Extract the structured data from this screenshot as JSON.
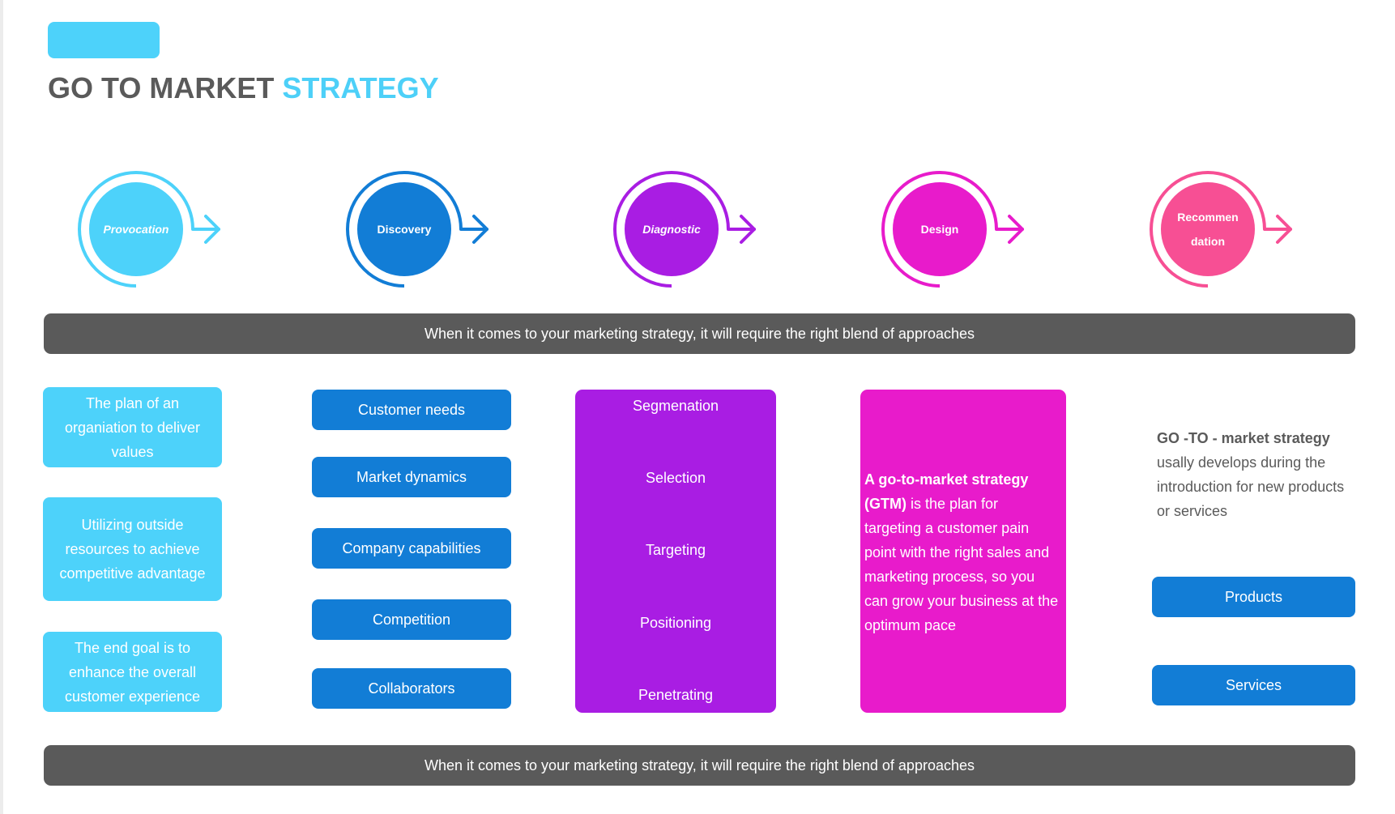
{
  "header": {
    "title_main": "GO TO MARKET ",
    "title_accent": "STRATEGY"
  },
  "colors": {
    "cyan": "#4dd2fa",
    "blue": "#127dd6",
    "purple": "#a91de3",
    "magenta": "#e81bcb",
    "pink": "#f74f94",
    "dark_gray": "#5a5a5a"
  },
  "stages": [
    {
      "label": "Provocation",
      "color": "#4dd2fa",
      "italic": true
    },
    {
      "label": "Discovery",
      "color": "#127dd6",
      "italic": false
    },
    {
      "label": "Diagnostic",
      "color": "#a91de3",
      "italic": true
    },
    {
      "label": "Design",
      "color": "#e81bcb",
      "italic": false
    },
    {
      "label": "Recommen dation",
      "color": "#f74f94",
      "italic": false
    }
  ],
  "banner_top": "When it comes to your marketing strategy, it will require the right blend of approaches",
  "banner_bottom": "When it comes to your marketing strategy, it will require the right blend of approaches",
  "column1": [
    "The plan of an organiation to deliver values",
    "Utilizing outside resources to achieve competitive advantage",
    "The end goal is to enhance the overall customer experience"
  ],
  "column2": [
    "Customer needs",
    "Market dynamics",
    "Company capabilities",
    "Competition",
    "Collaborators"
  ],
  "column3": [
    "Segmenation",
    "Selection",
    "Targeting",
    "Positioning",
    "Penetrating"
  ],
  "column4": {
    "bold": "A go-to-market strategy (GTM)",
    "rest": " is the plan for targeting a customer pain point with the right sales and marketing process, so you can grow your business at the optimum pace"
  },
  "column5": {
    "bold": "GO -TO - market strategy",
    "rest": " usally develops during the introduction for new products or services",
    "buttons": [
      "Products",
      "Services"
    ]
  }
}
